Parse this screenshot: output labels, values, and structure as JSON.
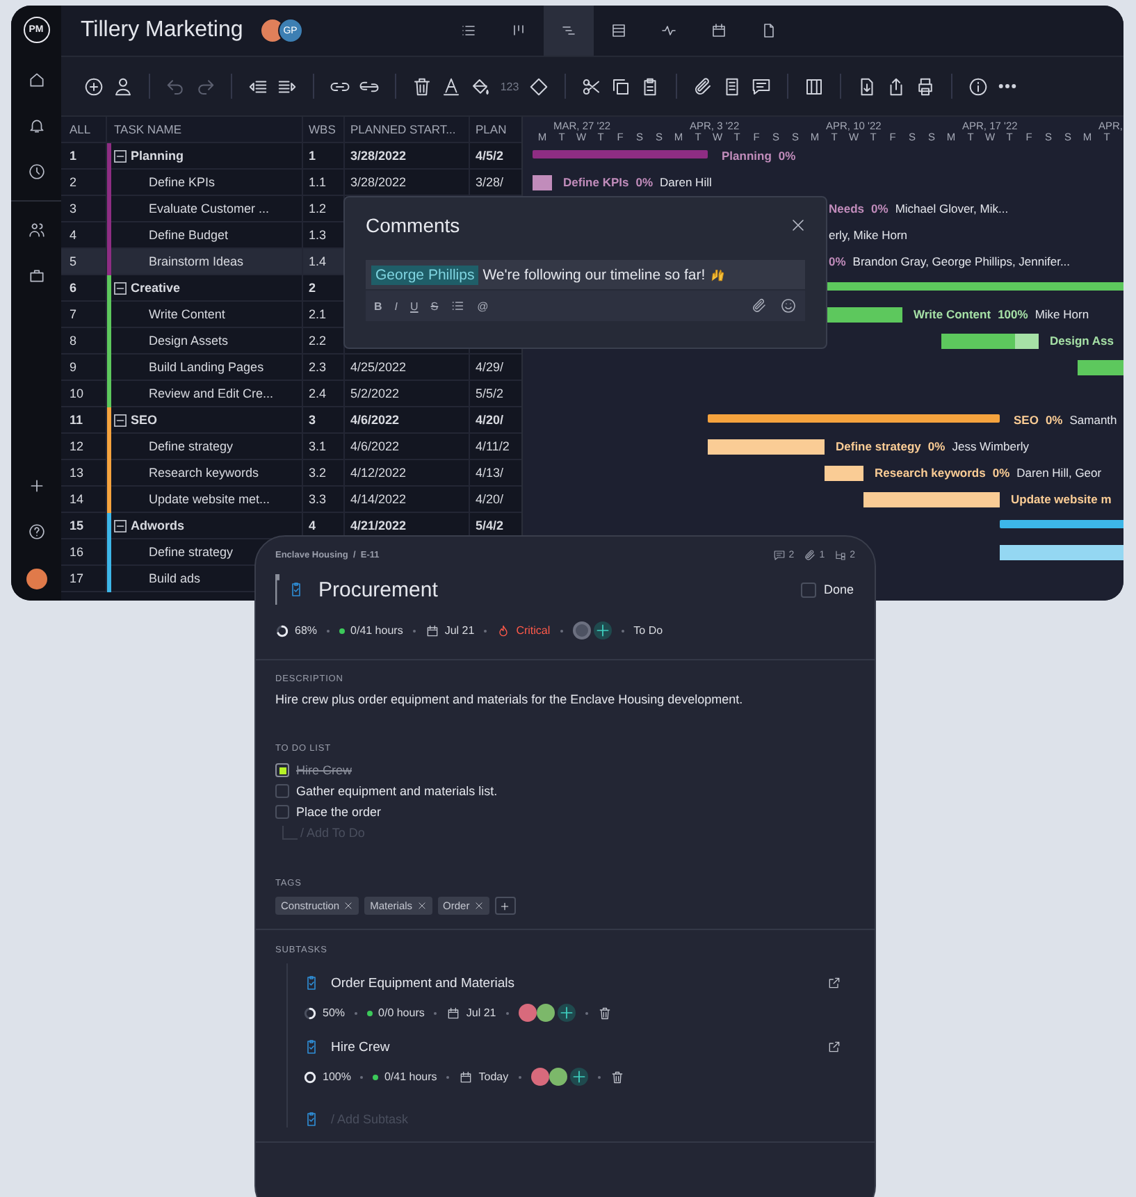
{
  "app": {
    "logo": "PM",
    "project_title": "Tillery Marketing",
    "members": [
      {
        "kind": "photo"
      },
      {
        "kind": "initials",
        "initials": "GP"
      }
    ]
  },
  "view_tabs": [
    {
      "selected": false
    },
    {
      "selected": false
    },
    {
      "selected": true
    },
    {
      "selected": false
    },
    {
      "selected": false
    },
    {
      "selected": false
    },
    {
      "selected": false
    }
  ],
  "toolbar": {
    "number_label": "123"
  },
  "grid": {
    "columns": [
      "ALL",
      "TASK NAME",
      "WBS",
      "PLANNED START...",
      "PLAN"
    ],
    "rows": [
      {
        "num": "1",
        "kind": "group",
        "name": "Planning",
        "wbs": "1",
        "start": "3/28/2022",
        "plan": "4/5/2",
        "color": "#8e2d83",
        "expanded": true,
        "selected": false,
        "label": {
          "name": "Planning",
          "pct": "0%"
        }
      },
      {
        "num": "2",
        "kind": "task",
        "name": "Define KPIs",
        "wbs": "1.1",
        "start": "3/28/2022",
        "plan": "3/28/",
        "color": "#8e2d83",
        "selected": false,
        "bar": {
          "level": 0
        },
        "label": {
          "name": "Define KPIs",
          "pct": "0%",
          "people": "Daren Hill"
        }
      },
      {
        "num": "3",
        "kind": "task",
        "name": "Evaluate Customer ...",
        "wbs": "1.2",
        "color": "#8e2d83",
        "selected": false,
        "label": {
          "name": "Needs",
          "pct": "0%",
          "people": "Michael Glover, Mik..."
        }
      },
      {
        "num": "4",
        "kind": "task",
        "name": "Define Budget",
        "wbs": "1.3",
        "color": "#8e2d83",
        "selected": false,
        "label": {
          "people": "erly, Mike Horn"
        }
      },
      {
        "num": "5",
        "kind": "task",
        "name": "Brainstorm Ideas",
        "wbs": "1.4",
        "color": "#8e2d83",
        "selected": true,
        "label": {
          "pct": "0%",
          "people": "Brandon Gray, George Phillips, Jennifer..."
        }
      },
      {
        "num": "6",
        "kind": "group",
        "name": "Creative",
        "wbs": "2",
        "color": "#5dc85d",
        "expanded": true,
        "selected": false
      },
      {
        "num": "7",
        "kind": "task",
        "name": "Write Content",
        "wbs": "2.1",
        "color": "#5dc85d",
        "selected": false,
        "bar": {
          "level": 1
        },
        "label": {
          "name": "Write Content",
          "pct": "100%",
          "people": "Mike Horn"
        }
      },
      {
        "num": "8",
        "kind": "task",
        "name": "Design Assets",
        "wbs": "2.2",
        "color": "#5dc85d",
        "selected": false,
        "bar": {
          "level": 0.75
        },
        "label": {
          "name": "Design Ass"
        }
      },
      {
        "num": "9",
        "kind": "task",
        "name": "Build Landing Pages",
        "wbs": "2.3",
        "start": "4/25/2022",
        "plan": "4/29/",
        "color": "#5dc85d",
        "selected": false,
        "bar": {
          "level": 1
        }
      },
      {
        "num": "10",
        "kind": "task",
        "name": "Review and Edit Cre...",
        "wbs": "2.4",
        "start": "5/2/2022",
        "plan": "5/5/2",
        "color": "#5dc85d",
        "selected": false
      },
      {
        "num": "11",
        "kind": "group",
        "name": "SEO",
        "wbs": "3",
        "start": "4/6/2022",
        "plan": "4/20/",
        "color": "#f5a33e",
        "expanded": true,
        "selected": false,
        "label": {
          "name": "SEO",
          "pct": "0%",
          "people": "Samanth"
        }
      },
      {
        "num": "12",
        "kind": "task",
        "name": "Define strategy",
        "wbs": "3.1",
        "start": "4/6/2022",
        "plan": "4/11/2",
        "color": "#f5a33e",
        "selected": false,
        "bar": {
          "level": 0
        },
        "label": {
          "name": "Define strategy",
          "pct": "0%",
          "people": "Jess Wimberly"
        }
      },
      {
        "num": "13",
        "kind": "task",
        "name": "Research keywords",
        "wbs": "3.2",
        "start": "4/12/2022",
        "plan": "4/13/",
        "color": "#f5a33e",
        "selected": false,
        "bar": {
          "level": 0
        },
        "label": {
          "name": "Research keywords",
          "pct": "0%",
          "people": "Daren Hill, Geor"
        }
      },
      {
        "num": "14",
        "kind": "task",
        "name": "Update website met...",
        "wbs": "3.3",
        "start": "4/14/2022",
        "plan": "4/20/",
        "color": "#f5a33e",
        "selected": false,
        "bar": {
          "level": 0
        },
        "label": {
          "name": "Update website m"
        }
      },
      {
        "num": "15",
        "kind": "group",
        "name": "Adwords",
        "wbs": "4",
        "start": "4/21/2022",
        "plan": "5/4/2",
        "color": "#3db6e8",
        "expanded": true,
        "selected": false
      },
      {
        "num": "16",
        "kind": "task",
        "name": "Define strategy",
        "color": "#3db6e8",
        "selected": false,
        "bar": {
          "level": 0
        }
      },
      {
        "num": "17",
        "kind": "task",
        "name": "Build ads",
        "color": "#3db6e8",
        "selected": false
      }
    ]
  },
  "gantt": {
    "weeks": [
      "MAR, 27 '22",
      "APR, 3 '22",
      "APR, 10 '22",
      "APR, 17 '22",
      "APR,"
    ],
    "days": [
      "M",
      "T",
      "W",
      "T",
      "F",
      "S",
      "S",
      "M",
      "T",
      "W",
      "T",
      "F",
      "S",
      "S",
      "M",
      "T",
      "W",
      "T",
      "F",
      "S",
      "S",
      "M",
      "T",
      "W",
      "T",
      "F",
      "S",
      "S",
      "M",
      "T"
    ]
  },
  "comments": {
    "title": "Comments",
    "mention": "George Phillips",
    "text": "We're following our timeline so far!",
    "format_buttons": [
      "B",
      "I",
      "U",
      "S"
    ],
    "mention_button": "@"
  },
  "task_panel": {
    "breadcrumb": "Enclave Housing  /  E-11",
    "counts": {
      "comments": "2",
      "attachments": "1",
      "subtasks": "2"
    },
    "title": "Procurement",
    "done": {
      "label": "Done",
      "checked": false
    },
    "meta": {
      "progress": "68%",
      "hours": "0/41 hours",
      "due": "Jul 21",
      "priority": "Critical",
      "status": "To Do"
    },
    "description_label": "DESCRIPTION",
    "description": "Hire crew plus order equipment and materials for the Enclave Housing development.",
    "todo_label": "TO DO LIST",
    "todos": [
      {
        "text": "Hire Crew",
        "checked": true
      },
      {
        "text": "Gather equipment and materials list.",
        "checked": false
      },
      {
        "text": "Place the order",
        "checked": false
      }
    ],
    "todo_placeholder": "/ Add To Do",
    "tags_label": "TAGS",
    "tags": [
      "Construction",
      "Materials",
      "Order"
    ],
    "subtasks_label": "SUBTASKS",
    "subtasks": [
      {
        "title": "Order Equipment and Materials",
        "progress": "50%",
        "hours": "0/0 hours",
        "due": "Jul 21"
      },
      {
        "title": "Hire Crew",
        "progress": "100%",
        "hours": "0/41 hours",
        "due": "Today"
      }
    ],
    "subtask_placeholder": "/ Add Subtask"
  }
}
